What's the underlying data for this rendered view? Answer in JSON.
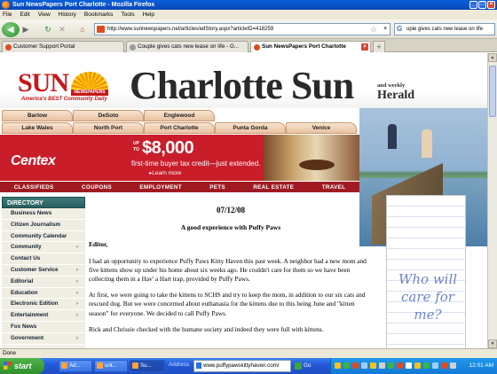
{
  "window": {
    "title": "Sun NewsPapers Port Charlotte - Mozilla Firefox"
  },
  "menu": [
    "File",
    "Edit",
    "View",
    "History",
    "Bookmarks",
    "Tools",
    "Help"
  ],
  "toolbar": {
    "url": "http://www.sunnewspapers.net/articles/edStory.aspx?articleID=418259",
    "search_text": "upie gives cats new lease on life",
    "search_engine_glyph": "G"
  },
  "tabs": [
    {
      "label": "Customer Support Portal",
      "favicon_color": "#e04a1f"
    },
    {
      "label": "Couple gives cats new lease on life - G...",
      "favicon_color": "#9c9c9c"
    },
    {
      "label": "Sun NewsPapers Port Charlotte",
      "favicon_color": "#e04a1f",
      "active": true
    }
  ],
  "masthead": {
    "sun_logo": "SUN",
    "sun_sub": "NEWSPAPERS",
    "tagline": "America's BEST Community Daily",
    "paper_name": "Charlotte Sun",
    "and_weekly": "and weekly",
    "herald": "Herald"
  },
  "towns": {
    "row1": [
      "Bartow",
      "DeSoto",
      "Englewood"
    ],
    "row2": [
      "Lake Wales",
      "North Port",
      "Port Charlotte",
      "Punta Gorda",
      "Venice"
    ]
  },
  "banner": {
    "brand": "Centex",
    "upto": "UP TO",
    "amount": "$8,000",
    "credit_text": "first-time buyer tax credit—just extended.",
    "learn_more": "▸Learn more"
  },
  "classifieds": [
    "CLASSIFIEDS",
    "COUPONS",
    "EMPLOYMENT",
    "PETS",
    "REAL ESTATE",
    "TRAVEL"
  ],
  "directory": {
    "heading": "DIRECTORY",
    "items": [
      {
        "label": "Business News",
        "has_sub": false
      },
      {
        "label": "Citizen Journalism",
        "has_sub": false
      },
      {
        "label": "Community Calendar",
        "has_sub": false
      },
      {
        "label": "Community",
        "has_sub": true
      },
      {
        "label": "Contact Us",
        "has_sub": false
      },
      {
        "label": "Customer Service",
        "has_sub": true
      },
      {
        "label": "Editorial",
        "has_sub": true
      },
      {
        "label": "Education",
        "has_sub": true
      },
      {
        "label": "Electronic Edition",
        "has_sub": true
      },
      {
        "label": "Entertainment",
        "has_sub": true
      },
      {
        "label": "Fox News",
        "has_sub": false
      },
      {
        "label": "Government",
        "has_sub": true
      }
    ],
    "arrow_glyph": "›"
  },
  "article": {
    "date": "07/12/08",
    "headline": "A good experience with Puffy Paws",
    "greeting": "Editor,",
    "paragraphs": [
      "I had an opportunity to experience Puffy Paws Kitty Haven this past week. A neighbor had a new mom and five kittens show up under his home about six weeks ago. He couldn't care for them so we have been collecting them in a Hav' a Hart trap, provided by Puffy Paws.",
      "At first, we were going to take the kittens to SCHS and try to keep the mom, in addition to our six cats and rescued dog. But we were concerned about euthanasia for the kittens due to this being June and \"kitten season\" for everyone. We decided to call Puffy Paws.",
      "Rick and Chrissie checked with the humane society and indeed they were full with kittens."
    ]
  },
  "ad": {
    "text": "Who will care for me?"
  },
  "status": "Done",
  "taskbar": {
    "start": "start",
    "items": [
      "Ad...",
      "unt...",
      "Su..."
    ],
    "address_label": "Address",
    "address_value": "www.puffypawskittyhaven.com/",
    "go": "Go",
    "clock": "12:01 AM"
  },
  "colors": {
    "accent_red": "#c81818",
    "directory_header": "#2a5e5e",
    "classifieds_bar": "#a11a22",
    "banner_red": "#c91d2a"
  }
}
